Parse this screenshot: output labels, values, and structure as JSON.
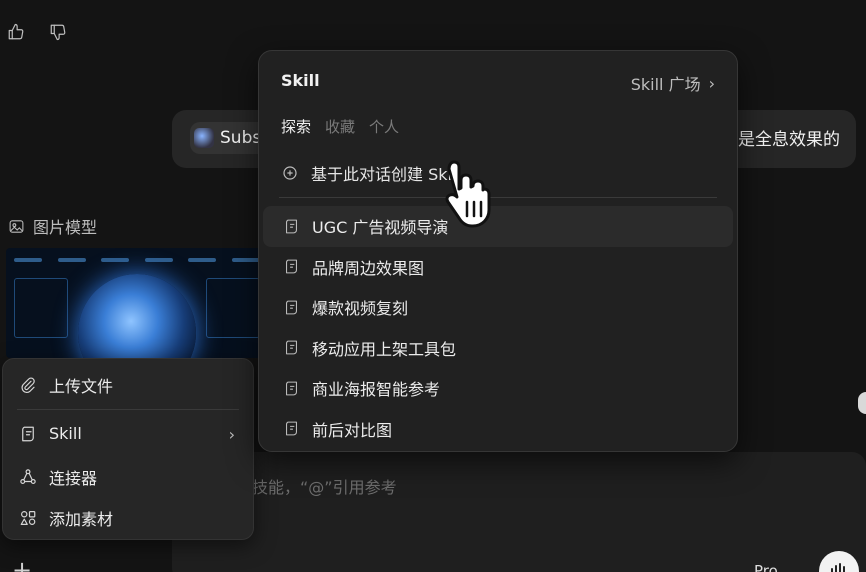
{
  "message": {
    "chip_label": "Subs",
    "tail_text": "是全息效果的"
  },
  "image_model_label": "图片模型",
  "composer": {
    "placeholder": "技能，“@”引用参考",
    "plus": "+",
    "model_select": "Pro ⌄"
  },
  "attach_menu": {
    "items": [
      {
        "label": "上传文件",
        "icon": "paperclip-icon"
      },
      {
        "label": "Skill",
        "icon": "skill-icon"
      },
      {
        "label": "连接器",
        "icon": "connector-icon"
      },
      {
        "label": "添加素材",
        "icon": "shapes-icon"
      }
    ],
    "chevron": "›"
  },
  "skill_popover": {
    "title": "Skill",
    "plaza_label": "Skill 广场",
    "plaza_chevron": "›",
    "tabs": [
      {
        "label": "探索",
        "active": true
      },
      {
        "label": "收藏",
        "active": false
      },
      {
        "label": "个人",
        "active": false
      }
    ],
    "create_label": "基于此对话创建 Skill",
    "items": [
      {
        "label": "UGC 广告视频导演"
      },
      {
        "label": "品牌周边效果图"
      },
      {
        "label": "爆款视频复刻"
      },
      {
        "label": "移动应用上架工具包"
      },
      {
        "label": "商业海报智能参考"
      },
      {
        "label": "前后对比图"
      }
    ]
  }
}
